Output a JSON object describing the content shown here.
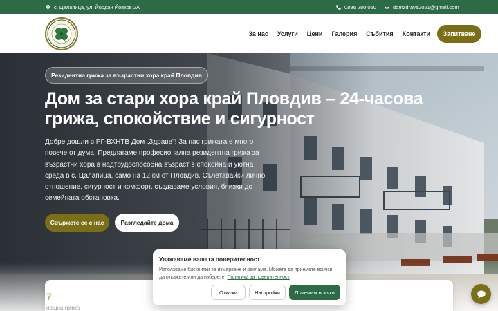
{
  "topbar": {
    "address": "с. Цалапица, ул. Йордан Йовков 2А",
    "phone": "0896 280 060",
    "email": "domzdrave2021@gmail.com"
  },
  "header": {
    "logo_text": "РГ-ВХНТВ Дом \"Здраве\"",
    "nav": [
      {
        "label": "За нас"
      },
      {
        "label": "Услуги"
      },
      {
        "label": "Цени"
      },
      {
        "label": "Галерия"
      },
      {
        "label": "Събития"
      },
      {
        "label": "Контакти"
      }
    ],
    "cta_label": "Запитване"
  },
  "hero": {
    "badge": "Резидентна грижа за възрастни хора край Пловдив",
    "title": "Дом за стари хора край Пловдив – 24-часова грижа, спокойствие и сигурност",
    "text": "Добре дошли в РГ-ВХНТВ Дом „Здраве\"! За нас грижата е много повече от дума. Предлагаме професионална резидентна грижа за възрастни хора в надтрудоспособна възраст в спокойна и уютна среда в с. Цалапица, само на 12 км от Пловдив. Съчетавайки лично отношение, сигурност и комфорт, създаваме условия, близки до семейната обстановка.",
    "primary_button": "Свържете се с нас",
    "secondary_button": "Разгледайте дома"
  },
  "stats": {
    "value": "7",
    "label": "нощна грижа"
  },
  "cookie": {
    "title": "Уважаваме вашата поверителност",
    "text": "Използваме бисквитки за измерване и реклама. Можете да приемете всички, да откажете или да изберете.",
    "link": "Политика за поверителност",
    "reject": "Откажи",
    "settings": "Настройки",
    "accept": "Приемам всички"
  },
  "colors": {
    "brand_green": "#2c6b46",
    "brand_olive": "#7a6e16"
  },
  "icons": {
    "address": "map-pin-icon",
    "phone": "phone-icon",
    "email": "mail-icon",
    "chat": "chat-icon"
  }
}
